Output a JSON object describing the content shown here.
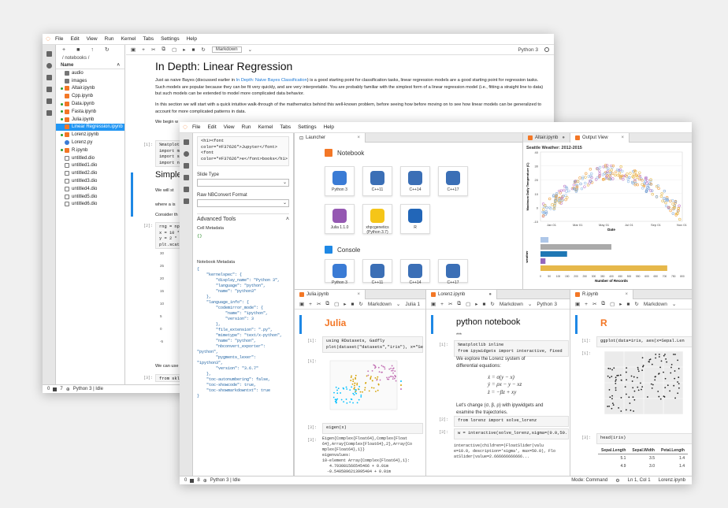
{
  "win1": {
    "menu": [
      "File",
      "Edit",
      "View",
      "Run",
      "Kernel",
      "Tabs",
      "Settings",
      "Help"
    ],
    "breadcrumb": "/ notebooks /",
    "col_name": "Name",
    "files": [
      {
        "name": "audio",
        "type": "folder",
        "dot": false
      },
      {
        "name": "images",
        "type": "folder",
        "dot": false
      },
      {
        "name": "Altair.ipynb",
        "type": "nb",
        "dot": true
      },
      {
        "name": "Cpp.ipynb",
        "type": "nb",
        "dot": false
      },
      {
        "name": "Data.ipynb",
        "type": "nb",
        "dot": true
      },
      {
        "name": "Fasta.ipynb",
        "type": "nb",
        "dot": true
      },
      {
        "name": "Julia.ipynb",
        "type": "nb",
        "dot": true
      },
      {
        "name": "Linear Regression.ipynb",
        "type": "nb",
        "dot": false,
        "selected": true
      },
      {
        "name": "Lorenz.ipynb",
        "type": "nb",
        "dot": true
      },
      {
        "name": "Lorenz.py",
        "type": "py",
        "dot": false
      },
      {
        "name": "R.ipynb",
        "type": "nb",
        "dot": true
      },
      {
        "name": "untitled.dio",
        "type": "file",
        "dot": false
      },
      {
        "name": "untitled1.dio",
        "type": "file",
        "dot": false
      },
      {
        "name": "untitled2.dio",
        "type": "file",
        "dot": false
      },
      {
        "name": "untitled3.dio",
        "type": "file",
        "dot": false
      },
      {
        "name": "untitled4.dio",
        "type": "file",
        "dot": false
      },
      {
        "name": "untitled5.dio",
        "type": "file",
        "dot": false
      },
      {
        "name": "untitled6.dio",
        "type": "file",
        "dot": false
      }
    ],
    "status": "Python 3 | Idle",
    "status_nums": [
      "0",
      "7"
    ],
    "nb_toolbar_mode": "Markdown",
    "kernel": "Python 3",
    "title": "In Depth: Linear Regression",
    "para1_a": "Just as naive Bayes (discussed earlier in ",
    "para1_link": "In Depth: Naive Bayes Classification",
    "para1_b": ") is a good starting point for classification tasks, linear regression models are a good starting point for regression tasks. Such models are popular because they can be fit very quickly, and are very interpretable. You are probably familiar with the simplest form of a linear regression model (i.e., fitting a straight line to data) but such models can be extended to model more complicated data behavior.",
    "para2": "In this section we will start with a quick intuitive walk-through of the mathematics behind this well-known problem, before seeing how before moving on to see how linear models can be generalized to account for more complicated patterns in data.",
    "para3": "We begin w",
    "prompt1": "[1]:",
    "code1": [
      "%matplotli",
      "import ma",
      "import se",
      "import nu"
    ],
    "h2": "Simple",
    "p_wewill": "We will st",
    "p_where": "where a is",
    "p_consider": "Consider th",
    "prompt2": "[2]:",
    "code2": [
      "rng = np.",
      "x = 10 *",
      "y = 2 * x",
      "plt.scatt"
    ],
    "axis_ticks": [
      "30",
      "25",
      "20",
      "15",
      "10",
      "5",
      "0",
      "-5"
    ],
    "p_wecan": "We can use",
    "prompt3": "[3]:",
    "code3": "from skle"
  },
  "win2": {
    "menu": [
      "File",
      "Edit",
      "View",
      "Run",
      "Kernel",
      "Tabs",
      "Settings",
      "Help"
    ],
    "cell_code": [
      "<h1><font",
      "color=\"#F37626\">Jupyter</font>",
      "<font",
      "color=\"#F37626\">e</font>books</h1>"
    ],
    "slide_type": "Slide Type",
    "raw_format": "Raw NBConvert Format",
    "advanced": "Advanced Tools",
    "cell_meta": "Cell Metadata",
    "cell_meta_val": "{}",
    "nb_meta": "Notebook Metadata",
    "nb_meta_json": [
      "{",
      "    \"kernelspec\": {",
      "        \"display_name\": \"Python 3\",",
      "        \"language\": \"python\",",
      "        \"name\": \"python3\"",
      "    },",
      "    \"language_info\": {",
      "        \"codemirror_mode\": {",
      "            \"name\": \"ipython\",",
      "            \"version\": 3",
      "        },",
      "        \"file_extension\": \".py\",",
      "        \"mimetype\": \"text/x-python\",",
      "        \"name\": \"python\",",
      "        \"nbconvert_exporter\":",
      "\"python\",",
      "        \"pygments_lexer\":",
      "\"ipython3\",",
      "        \"version\": \"3.6.7\"",
      "    },",
      "    \"toc-autonumbering\": false,",
      "    \"toc-showcode\": true,",
      "    \"toc-showmarkdowntxt\": true",
      "}"
    ],
    "status_left": [
      "0",
      "8",
      "Python 3 | Idle"
    ],
    "status_right": [
      "Mode: Command",
      "Ln 1, Col 1",
      "Lorenz.ipynb"
    ],
    "launcher_tab": "Launcher",
    "notebook_section": "Notebook",
    "kernels": [
      {
        "label": "Python 3",
        "color": "#3a7bd5"
      },
      {
        "label": "C++11",
        "color": "#3b6fb6"
      },
      {
        "label": "C++14",
        "color": "#3b6fb6"
      },
      {
        "label": "C++17",
        "color": "#3b6fb6"
      },
      {
        "label": "Julia 1.1.0",
        "color": "#9558b2"
      },
      {
        "label": "xhpcgenetics (Python 3.7)",
        "color": "#f5c518"
      },
      {
        "label": "R",
        "color": "#2266b8"
      }
    ],
    "console_section": "Console",
    "console_kernels": [
      "Python 3",
      "C++11",
      "C++14",
      "C++17"
    ],
    "tab_altair": "Altair.ipynb",
    "tab_output": "Output View",
    "chart_title": "Seattle Weather: 2012-2015",
    "chart_ylabel": "Maximum Daily Temperature (C)",
    "chart_xlabel": "Date",
    "chart_xticks": [
      "Jan 01",
      "Mar 01",
      "May 01",
      "Jul 01",
      "Sep 01",
      "Nov 01"
    ],
    "chart_yticks": [
      "40",
      "30",
      "20",
      "10",
      "0",
      "-10"
    ],
    "bar_ylabel": "weather",
    "bar_xlabel": "Number of Records",
    "bar_xticks": [
      "0",
      "50",
      "100",
      "150",
      "200",
      "250",
      "300",
      "350",
      "400",
      "450",
      "500",
      "550",
      "600",
      "650",
      "700",
      "750",
      "800"
    ],
    "julia_tab": "Julia.ipynb",
    "julia_title": "Julia",
    "julia_prompt1": "[1]:",
    "julia_code1": [
      "using RDatasets, Gadfly",
      "plot(dataset(\"datasets\",\"iris\"), x=\"Se"
    ],
    "julia_prompt2": "[1]:",
    "julia_prompt3": "[3]:",
    "julia_code3": "eigen(x)",
    "julia_prompt4": "[3]:",
    "julia_out": [
      "Eigen{Complex{Float64},Complex{Float",
      "64},Array{Complex{Float64},2},Array{Co",
      "mplex{Float64},1}}",
      "eigenvalues:",
      "10-element Array{Complex{Float64},1}:",
      "   4.793081566545466 + 0.0im",
      "  -0.5405896213995404 + 0.0im"
    ],
    "lorenz_tab": "Lorenz.ipynb",
    "lorenz_title": "python notebook",
    "lorenz_stars": "***",
    "lorenz_prompt1": "[1]:",
    "lorenz_code1": [
      "%matplotlib inline",
      "from ipywidgets import interactive, fixed"
    ],
    "lorenz_p1": "We explore the Lorenz system of differential equations:",
    "lorenz_eqs": [
      "ẋ = σ(y − x)",
      "ẏ = ρx − y − xz",
      "ż = −βz + xy"
    ],
    "lorenz_p2": "Let's change (σ, β, ρ) with ipywidgets and examine the trajectories.",
    "lorenz_prompt2": "[2]:",
    "lorenz_code2": "from lorenz import solve_lorenz",
    "lorenz_prompt3": "[3]:",
    "lorenz_code3": "w = interactive(solve_lorenz,sigma=(0.0,50.",
    "lorenz_out": [
      "interactive(children=(FloatSlider(valu",
      "e=10.0, description='sigma', max=50.0), Flo",
      "atSlider(value=2.666666666666..."
    ],
    "r_tab": "R.ipynb",
    "r_title": "R",
    "r_prompt1": "[1]:",
    "r_code1": "ggplot(data=iris, aes(x=Sepal.Len",
    "r_prompt2": "[1]:",
    "r_prompt3": "[3]:",
    "r_code3": "head(iris)",
    "r_table_head": [
      "Sepal.Length",
      "Sepal.Width",
      "Petal.Length"
    ],
    "r_table_rows": [
      [
        "5.1",
        "3.5",
        "1.4"
      ],
      [
        "4.9",
        "3.0",
        "1.4"
      ]
    ],
    "mode_markdown": "Markdown",
    "kernel_julia": "Julia 1",
    "kernel_py": "Python 3"
  }
}
